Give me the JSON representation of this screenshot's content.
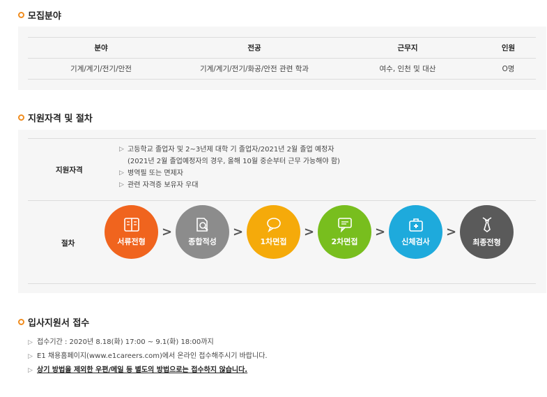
{
  "section1": {
    "title": "모집분야",
    "headers": [
      "분야",
      "전공",
      "근무지",
      "인원"
    ],
    "row": [
      "기계/계기/전기/안전",
      "기계/계기/전기/화공/안전 관련 학과",
      "여수, 인천 및 대산",
      "O명"
    ]
  },
  "section2": {
    "title": "지원자격 및 절차",
    "qual_label": "지원자격",
    "qual_items": [
      "고등학교 졸업자 및 2~3년제 대학 기 졸업자/2021년 2월 졸업 예정자",
      "(2021년 2월 졸업예정자의 경우, 올해 10월 중순부터 근무 가능해야 함)",
      "병역필 또는 면제자",
      "관련 자격증 보유자 우대"
    ],
    "proc_label": "절차",
    "steps": [
      {
        "label": "서류전형",
        "icon": "book-icon",
        "color": "#f0641e"
      },
      {
        "label": "종합적성",
        "icon": "document-search-icon",
        "color": "#8c8c8c"
      },
      {
        "label": "1차면접",
        "icon": "speech-bubble-icon",
        "color": "#f5aa0a"
      },
      {
        "label": "2차면접",
        "icon": "chat-box-icon",
        "color": "#78be1e"
      },
      {
        "label": "신체검사",
        "icon": "medical-kit-icon",
        "color": "#1eaadc"
      },
      {
        "label": "최종전형",
        "icon": "necktie-icon",
        "color": "#5a5a5a"
      }
    ],
    "arrow": ">"
  },
  "section3": {
    "title": "입사지원서 접수",
    "items": [
      "접수기간 : 2020년 8.18(화) 17:00 ~ 9.1(화) 18:00까지",
      "E1 채용홈페이지(www.e1careers.com)에서 온라인 접수해주시기 바랍니다.",
      "상기 방법을 제외한 우편/메일 등 별도의 방법으로는 접수하지 않습니다."
    ],
    "arrow": "▷"
  }
}
